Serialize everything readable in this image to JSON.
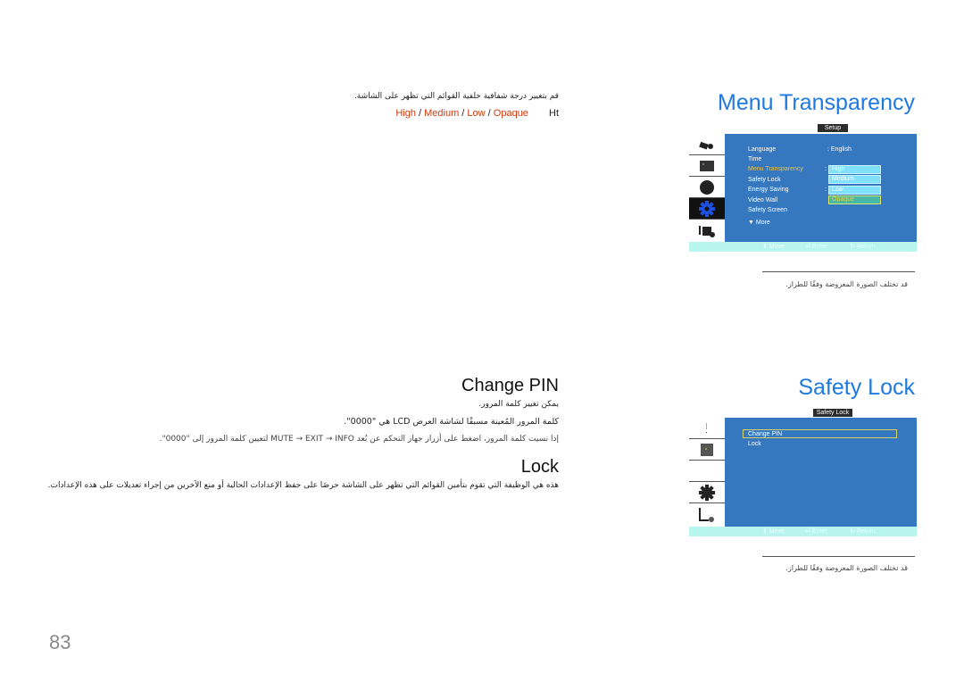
{
  "page_number": "83",
  "menu_transparency": {
    "heading": "Menu Transparency",
    "description": "قم بتغيير درجة شفافية خلفية القوائم التي تظهر على الشاشة.",
    "options_prefix": "Ht",
    "options": [
      "High",
      "Medium",
      "Low",
      "Opaque"
    ],
    "separator": " / ",
    "osd": {
      "title": "Setup",
      "side_icons": [
        "picture-icon",
        "sound-icon",
        "channel-icon",
        "setup-gear-icon",
        "input-icon"
      ],
      "active_side_index": 3,
      "items": [
        {
          "label": "Language",
          "value": ": English"
        },
        {
          "label": "Time",
          "value": ""
        },
        {
          "label": "Menu Transparency",
          "value": ":"
        },
        {
          "label": "Safety Lock",
          "value": ""
        },
        {
          "label": "Energy Saving",
          "value": ":"
        },
        {
          "label": "Video Wall",
          "value": ""
        },
        {
          "label": "Safety Screen",
          "value": ""
        }
      ],
      "selected_item": "Menu Transparency",
      "more_label": "▼ More",
      "dropdown": [
        "High",
        "Medium",
        "Low",
        "Opaque"
      ],
      "dropdown_selected": "Opaque",
      "footer": {
        "move": "Move",
        "enter": "Enter",
        "return": "Return"
      }
    },
    "note": "قد تختلف الصورة المعروضة وفقًا للطراز."
  },
  "safety_lock": {
    "heading": "Safety Lock",
    "osd": {
      "title": "Safety Lock",
      "side_icons": [
        "info-icon",
        "picture-icon",
        "blank-icon",
        "setup-gear-icon",
        "input-icon"
      ],
      "items": [
        "Change PIN",
        "Lock"
      ],
      "selected_item": "Change PIN",
      "footer": {
        "move": "Move",
        "enter": "Enter",
        "return": "Return"
      }
    },
    "note": "قد تختلف الصورة المعروضة وفقًا للطراز."
  },
  "change_pin": {
    "heading": "Change PIN",
    "line1": "يمكن تغيير كلمة المرور.",
    "line2": "كلمة المرور المُعينة مسبقًا لشاشة العرض LCD هي \"0000\".",
    "bullet": "إذا نسيت كلمة المرور، اضغط على أزرار جهاز التحكم عن بُعد MUTE → EXIT → INFO لتعيين كلمة المرور إلى \"0000\"."
  },
  "lock": {
    "heading": "Lock",
    "description": "هذه هي الوظيفة التي تقوم بتأمين القوائم التي تظهر على الشاشة حرصًا على حفظ الإعدادات الحالية أو منع الآخرين من إجراء تعديلات على هذه الإعدادات."
  }
}
